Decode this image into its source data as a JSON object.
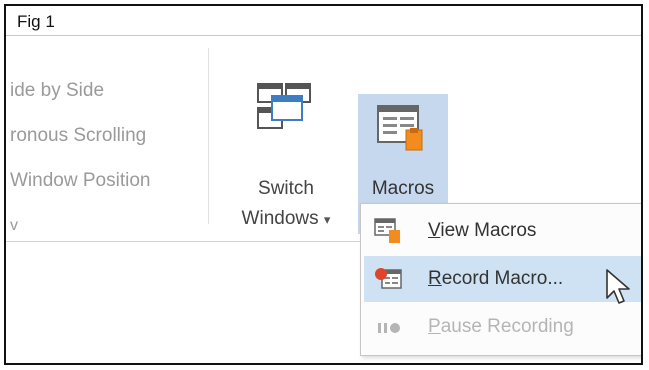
{
  "figure": {
    "label": "Fig 1"
  },
  "window_group": {
    "items": [
      {
        "label": "ide by Side"
      },
      {
        "label": "ronous Scrolling"
      },
      {
        "label": "Window Position"
      },
      {
        "label": "v"
      }
    ]
  },
  "switch_windows": {
    "line1": "Switch",
    "line2": "Windows",
    "arrow": "▾"
  },
  "macros": {
    "label": "Macros",
    "arrow": "▾"
  },
  "macros_menu": {
    "items": [
      {
        "accel": "V",
        "rest": "iew Macros",
        "icon": "view-macros-icon",
        "state": "normal"
      },
      {
        "accel": "R",
        "rest": "ecord Macro...",
        "icon": "record-macro-icon",
        "state": "hover"
      },
      {
        "accel": "P",
        "rest": "ause Recording",
        "icon": "pause-recording-icon",
        "state": "disabled"
      }
    ]
  },
  "colors": {
    "macros_button_bg": "#c5d8ed",
    "menu_hover_bg": "#cfe2f3",
    "record_red": "#e0452b",
    "icon_orange": "#f28c1e"
  }
}
